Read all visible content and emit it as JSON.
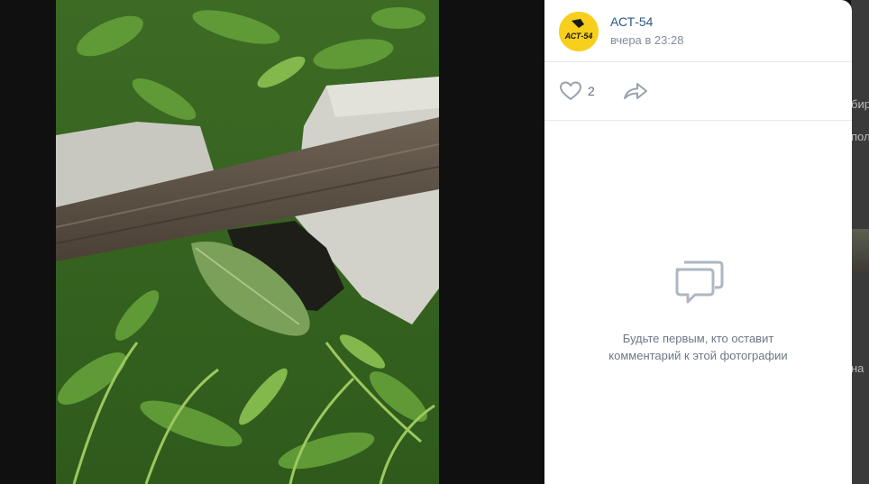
{
  "post": {
    "author": "АСТ-54",
    "time": "вчера в 23:28",
    "avatar_text": "АСТ-54",
    "likes": "2"
  },
  "comments": {
    "empty_line1": "Будьте первым, кто оставит",
    "empty_line2": "комментарий к этой фотографии"
  },
  "background_page": {
    "fragments": [
      "бир",
      "пол",
      "на"
    ]
  },
  "icons": {
    "like": "heart-icon",
    "share": "share-arrow-icon",
    "empty": "comments-bubbles-icon"
  },
  "colors": {
    "accent_link": "#2a5885",
    "muted_text": "#818c99",
    "avatar_bg": "#f7cf1c"
  }
}
